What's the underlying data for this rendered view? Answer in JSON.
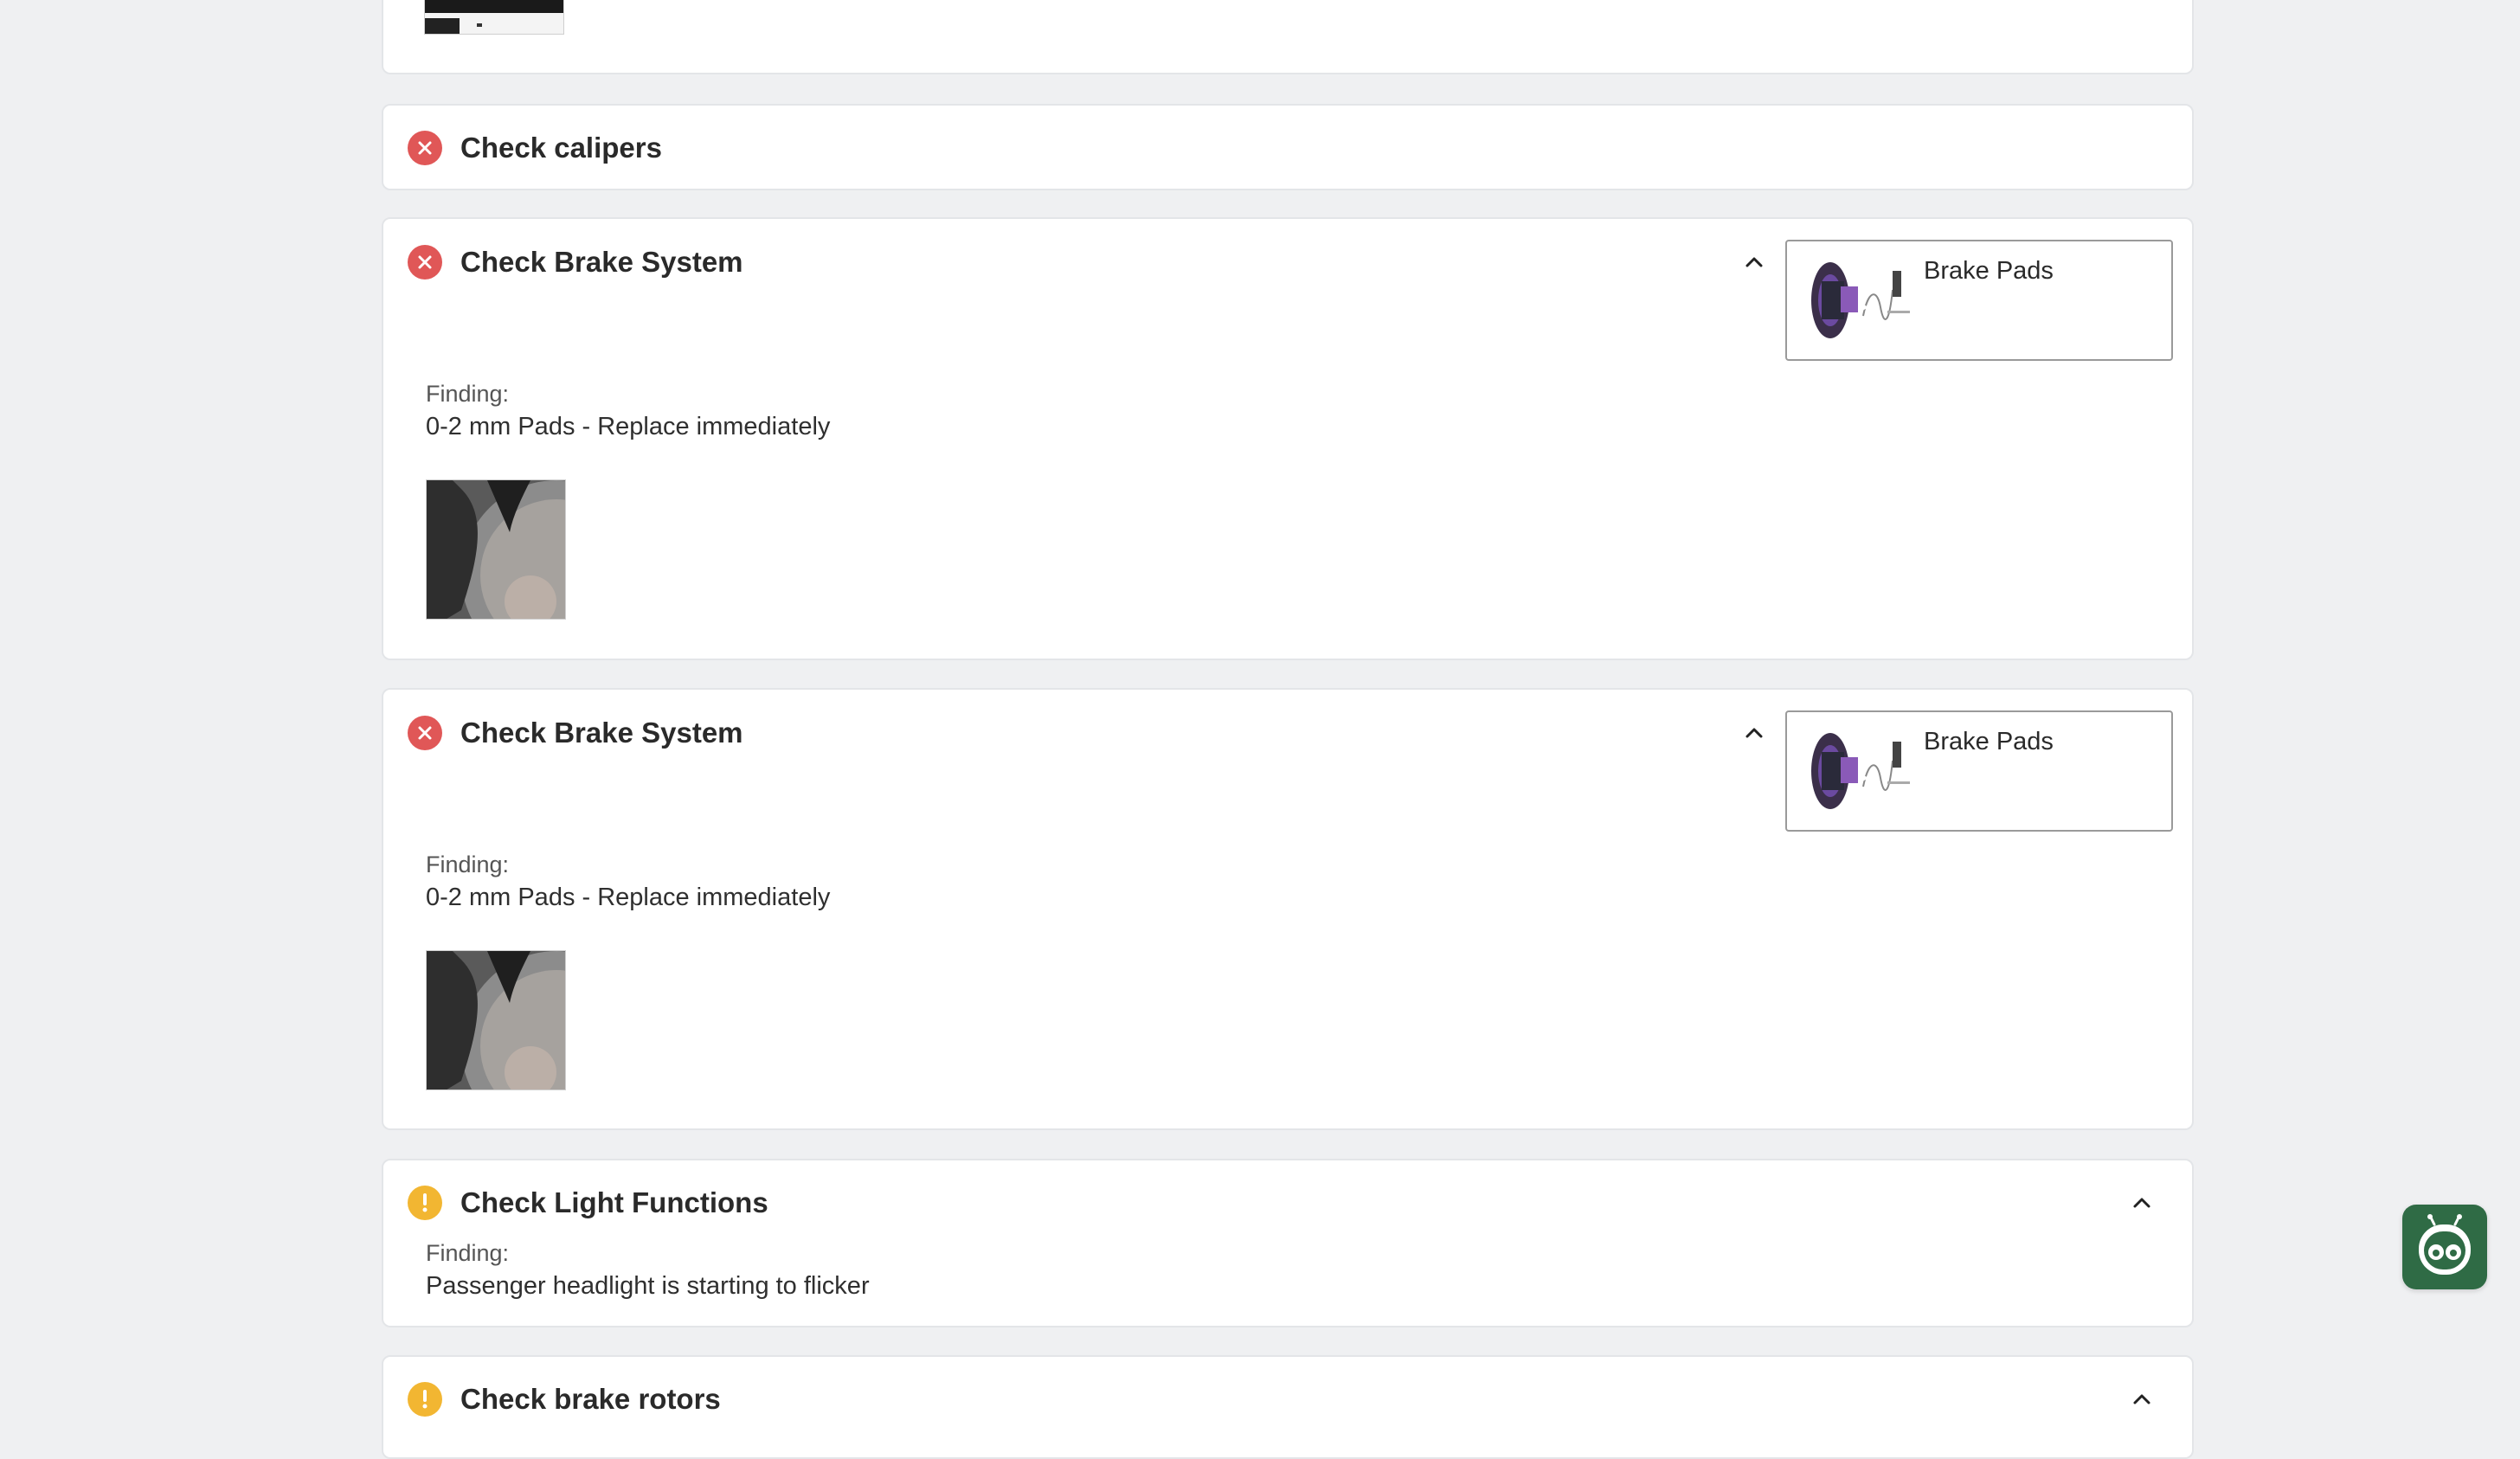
{
  "inspection_items": [
    {
      "title": "Check calipers",
      "status": "failed"
    },
    {
      "title": "Check Brake System",
      "status": "failed",
      "part_label": "Brake Pads",
      "finding_label": "Finding:",
      "finding_value": "0-2 mm Pads - Replace immediately"
    },
    {
      "title": "Check Brake System",
      "status": "failed",
      "part_label": "Brake Pads",
      "finding_label": "Finding:",
      "finding_value": "0-2 mm Pads - Replace immediately"
    },
    {
      "title": "Check Light Functions",
      "status": "warning",
      "finding_label": "Finding:",
      "finding_value": "Passenger headlight is starting to flicker"
    },
    {
      "title": "Check brake rotors",
      "status": "warning"
    }
  ],
  "colors": {
    "failed": "#e05757",
    "warning": "#f2b632",
    "assistant_button": "#2f6b45",
    "page_background": "#eff0f2"
  },
  "icons": {
    "failed": "x-circle-icon",
    "warning": "exclamation-circle-icon",
    "collapse": "chevron-up-icon",
    "assistant": "robot-assistant-icon"
  }
}
